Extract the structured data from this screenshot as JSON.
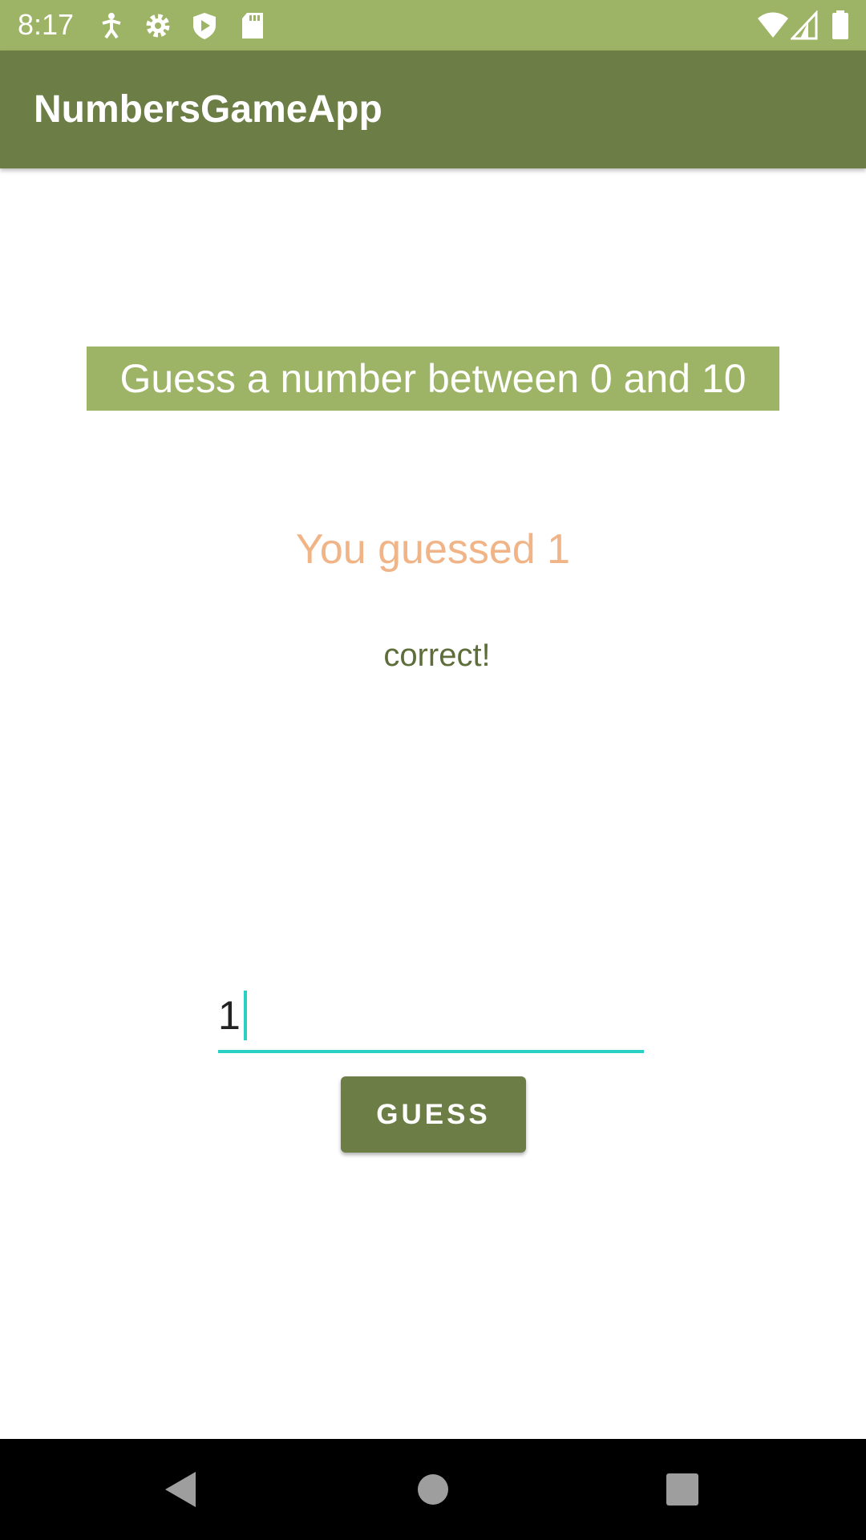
{
  "status_bar": {
    "time": "8:17",
    "left_icons": [
      "accessibility-icon",
      "gear-icon",
      "shield-play-icon",
      "sd-card-icon"
    ],
    "right_icons": [
      "wifi-icon",
      "cell-signal-icon",
      "battery-icon"
    ]
  },
  "app_bar": {
    "title": "NumbersGameApp"
  },
  "main": {
    "prompt": "Guess a number between 0 and 10",
    "guess_echo": "You guessed 1",
    "result": "correct!",
    "input_value": "1",
    "guess_button_label": "GUESS"
  },
  "nav_bar": {
    "icons": [
      "back-icon",
      "home-icon",
      "recents-icon"
    ]
  },
  "colors": {
    "status_bar": "#9db365",
    "app_bar": "#6c7e46",
    "banner": "#9db365",
    "guess_echo": "#f0b487",
    "result": "#5e6e3a",
    "input_accent": "#2ad0c4",
    "button": "#6c7e46"
  }
}
